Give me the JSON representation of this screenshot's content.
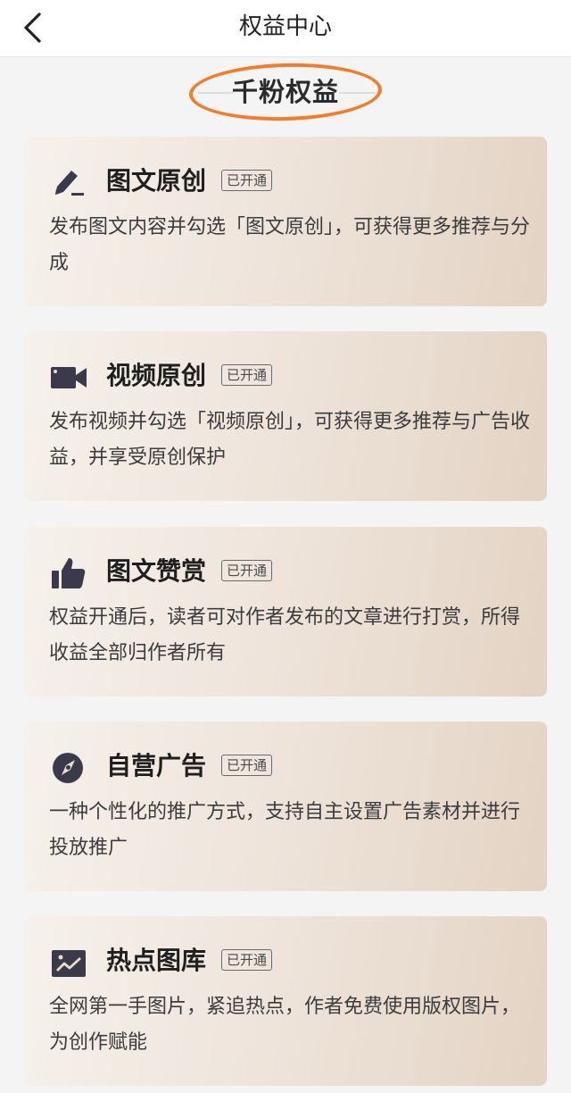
{
  "nav": {
    "title": "权益中心"
  },
  "section": {
    "title": "千粉权益"
  },
  "cards": [
    {
      "icon": "pencil-icon",
      "title": "图文原创",
      "badge": "已开通",
      "description": "发布图文内容并勾选「图文原创」，可获得更多推荐与分成"
    },
    {
      "icon": "video-camera-icon",
      "title": "视频原创",
      "badge": "已开通",
      "description": "发布视频并勾选「视频原创」，可获得更多推荐与广告收益，并享受原创保护"
    },
    {
      "icon": "thumbs-up-icon",
      "title": "图文赞赏",
      "badge": "已开通",
      "description": "权益开通后，读者可对作者发布的文章进行打赏，所得收益全部归作者所有"
    },
    {
      "icon": "compass-icon",
      "title": "自营广告",
      "badge": "已开通",
      "description": "一种个性化的推广方式，支持自主设置广告素材并进行投放推广"
    },
    {
      "icon": "image-gallery-icon",
      "title": "热点图库",
      "badge": "已开通",
      "description": "全网第一手图片，紧追热点，作者免费使用版权图片，为创作赋能"
    }
  ],
  "colors": {
    "highlight_oval": "#f07c2c",
    "icon": "#3a3a4a",
    "card_gradient_start": "#f6f1ec",
    "card_gradient_end": "#e3d3c4"
  }
}
